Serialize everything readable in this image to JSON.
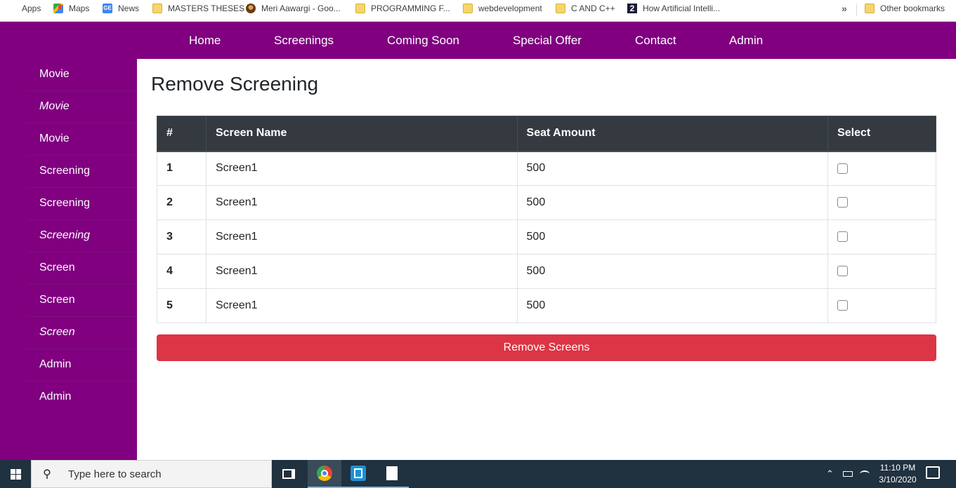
{
  "bookmarks": {
    "items": [
      {
        "label": "Apps",
        "icon": "apps-grid-icon"
      },
      {
        "label": "Maps",
        "icon": "maps-icon"
      },
      {
        "label": "News",
        "icon": "news-icon"
      },
      {
        "label": "MASTERS THESES",
        "icon": "folder-icon"
      },
      {
        "label": "Meri Aawargi - Goo...",
        "icon": "site-favicon"
      },
      {
        "label": "PROGRAMMING F...",
        "icon": "folder-icon"
      },
      {
        "label": "webdevelopment",
        "icon": "folder-icon"
      },
      {
        "label": "C AND C++",
        "icon": "folder-icon"
      },
      {
        "label": "How Artificial Intelli...",
        "icon": "site-favicon"
      }
    ],
    "overflow": "»",
    "other": "Other bookmarks"
  },
  "nav": {
    "items": [
      "Home",
      "Screenings",
      "Coming Soon",
      "Special Offer",
      "Contact",
      "Admin"
    ]
  },
  "sidebar": {
    "items": [
      {
        "glyph": "",
        "label": "Movie"
      },
      {
        "glyph": "",
        "label": "Movie"
      },
      {
        "glyph": "",
        "label": "Movie"
      },
      {
        "glyph": "",
        "label": "Screening"
      },
      {
        "glyph": "",
        "label": "Screening"
      },
      {
        "glyph": "",
        "label": "Screening"
      },
      {
        "glyph": "",
        "label": "Screen"
      },
      {
        "glyph": "",
        "label": "Screen"
      },
      {
        "glyph": "",
        "label": "Screen"
      },
      {
        "glyph": "",
        "label": "Admin"
      },
      {
        "glyph": "",
        "label": "Admin"
      }
    ]
  },
  "main": {
    "title": "Remove Screening",
    "table": {
      "headers": [
        "#",
        "Screen Name",
        "Seat Amount",
        "Select"
      ],
      "rows": [
        {
          "num": "1",
          "name": "Screen1",
          "seats": "500",
          "selected": false
        },
        {
          "num": "2",
          "name": "Screen1",
          "seats": "500",
          "selected": false
        },
        {
          "num": "3",
          "name": "Screen1",
          "seats": "500",
          "selected": false
        },
        {
          "num": "4",
          "name": "Screen1",
          "seats": "500",
          "selected": false
        },
        {
          "num": "5",
          "name": "Screen1",
          "seats": "500",
          "selected": false
        }
      ]
    },
    "button": "Remove Screens"
  },
  "taskbar": {
    "search_placeholder": "Type here to search",
    "time": "11:10 PM",
    "date": "3/10/2020"
  },
  "colors": {
    "nav_bg": "#800080",
    "table_header_bg": "#343a40",
    "danger": "#dc3545",
    "taskbar_bg": "#20313f"
  }
}
